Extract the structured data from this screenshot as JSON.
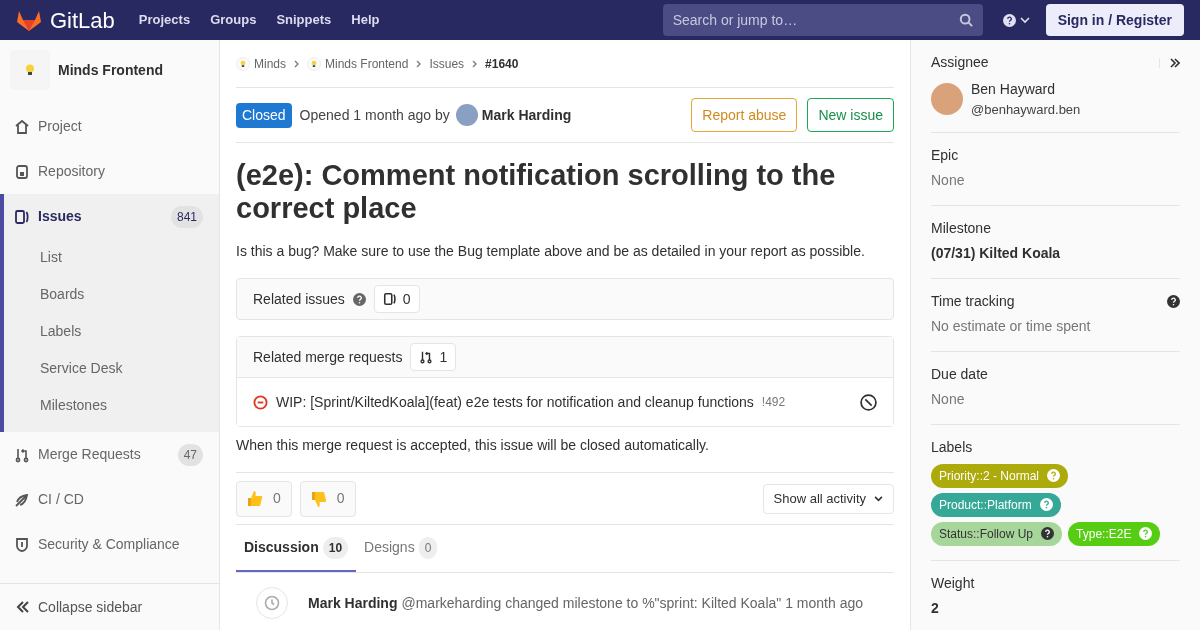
{
  "header": {
    "logo_text": "GitLab",
    "nav": [
      "Projects",
      "Groups",
      "Snippets",
      "Help"
    ],
    "search": {
      "placeholder": "Search or jump to…"
    },
    "sign_in": "Sign in / Register"
  },
  "sidebar": {
    "project": "Minds Frontend",
    "items": [
      {
        "label": "Project",
        "selected": false
      },
      {
        "label": "Repository",
        "selected": false
      },
      {
        "label": "Issues",
        "selected": true,
        "count": "841",
        "children": [
          "List",
          "Boards",
          "Labels",
          "Service Desk",
          "Milestones"
        ]
      },
      {
        "label": "Merge Requests",
        "selected": false,
        "count": "47"
      },
      {
        "label": "CI / CD",
        "selected": false
      },
      {
        "label": "Security & Compliance",
        "selected": false
      }
    ],
    "collapse": "Collapse sidebar"
  },
  "breadcrumbs": [
    "Minds",
    "Minds Frontend",
    "Issues",
    "#1640"
  ],
  "issue": {
    "status": "Closed",
    "opened": "Opened 1 month ago by",
    "author": "Mark Harding",
    "report": "Report abuse",
    "new_issue": "New issue",
    "title": "(e2e): Comment notification scrolling to the correct place",
    "description": "Is this a bug? Make sure to use the Bug template above and be as detailed in your report as possible."
  },
  "related_issues": {
    "title": "Related issues",
    "count": "0"
  },
  "related_mrs": {
    "title": "Related merge requests",
    "count": "1",
    "items": [
      {
        "title": "WIP: [Sprint/KiltedKoala](feat) e2e tests for notification and cleanup functions",
        "ref": "!492"
      }
    ],
    "note": "When this merge request is accepted, this issue will be closed automatically."
  },
  "reactions": [
    {
      "count": "0"
    },
    {
      "count": "0"
    }
  ],
  "activity_filter": "Show all activity",
  "tabs": [
    {
      "label": "Discussion",
      "count": "10",
      "selected": true
    },
    {
      "label": "Designs",
      "count": "0",
      "selected": false
    }
  ],
  "activity": [
    {
      "author": "Mark Harding",
      "text": "@markeharding changed milestone to %\"sprint: Kilted Koala\" 1 month ago"
    }
  ],
  "right": {
    "assignee": {
      "heading": "Assignee",
      "name": "Ben Hayward",
      "handle": "@benhayward.ben"
    },
    "sections": [
      {
        "kind": "text",
        "heading": "Epic",
        "value": "None"
      },
      {
        "kind": "bold",
        "heading": "Milestone",
        "value": "(07/31) Kilted Koala"
      },
      {
        "kind": "help",
        "heading": "Time tracking",
        "value": "No estimate or time spent"
      },
      {
        "kind": "text",
        "heading": "Due date",
        "value": "None"
      },
      {
        "kind": "labels",
        "heading": "Labels",
        "labels": [
          {
            "text": "Priority::2 - Normal",
            "color": "#adaa0c"
          },
          {
            "text": "Product::Platform",
            "color": "#36a897"
          },
          {
            "text": "Status::Follow Up",
            "color": "#a7d69a"
          },
          {
            "text": "Type::E2E",
            "color": "#56cc12"
          }
        ]
      },
      {
        "kind": "bold",
        "heading": "Weight",
        "value": "2"
      }
    ]
  }
}
